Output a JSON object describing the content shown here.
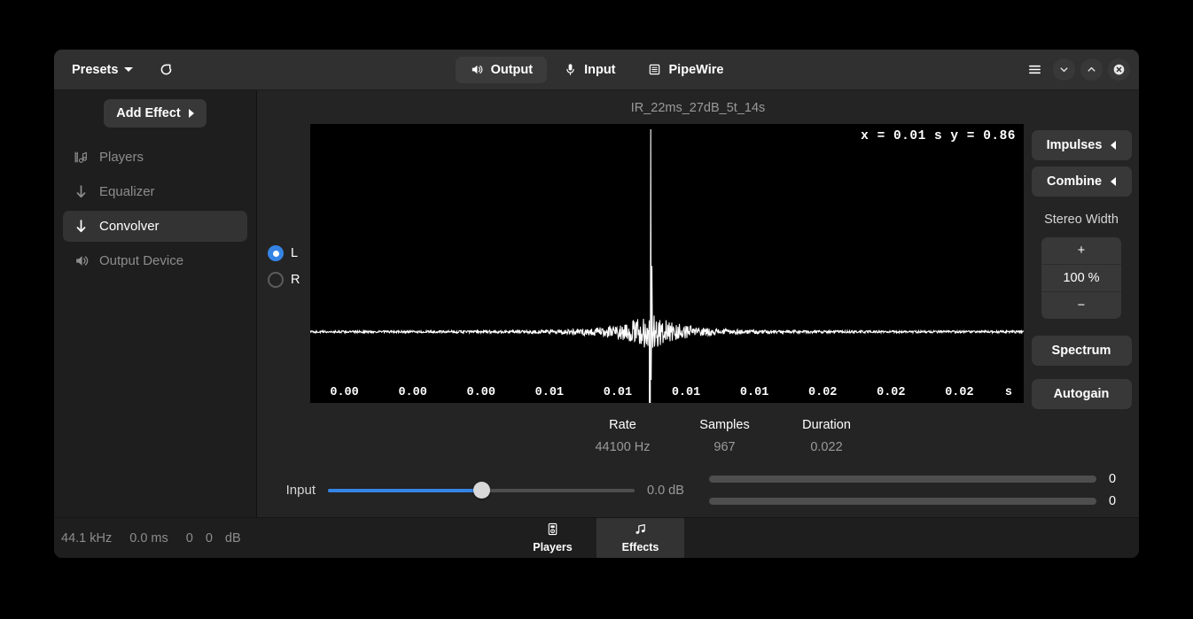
{
  "header": {
    "presets_label": "Presets",
    "presets_icon": "chevron-down-icon",
    "reset_icon": "reset-icon",
    "tabs": [
      {
        "label": "Output",
        "icon": "speaker-icon",
        "active": true
      },
      {
        "label": "Input",
        "icon": "microphone-icon",
        "active": false
      },
      {
        "label": "PipeWire",
        "icon": "list-icon",
        "active": false
      }
    ],
    "window_buttons": [
      {
        "name": "menu-button",
        "icon": "hamburger-icon"
      },
      {
        "name": "minimize-button",
        "icon": "chevron-down-icon"
      },
      {
        "name": "maximize-button",
        "icon": "chevron-up-icon"
      },
      {
        "name": "close-button",
        "icon": "close-circle-icon"
      }
    ]
  },
  "sidebar": {
    "add_effect_label": "Add Effect",
    "add_effect_icon": "chevron-right-icon",
    "items": [
      {
        "label": "Players",
        "icon": "players-icon",
        "active": false
      },
      {
        "label": "Equalizer",
        "icon": "arrow-down-icon",
        "active": false
      },
      {
        "label": "Convolver",
        "icon": "arrow-down-icon",
        "active": true
      },
      {
        "label": "Output Device",
        "icon": "speaker-icon",
        "active": false
      }
    ]
  },
  "main": {
    "ir_title": "IR_22ms_27dB_5t_14s",
    "channels": [
      {
        "label": "L",
        "selected": true
      },
      {
        "label": "R",
        "selected": false
      }
    ],
    "readout": "x = 0.01 s  y = 0.86",
    "info": [
      {
        "label": "Rate",
        "value": "44100 Hz"
      },
      {
        "label": "Samples",
        "value": "967"
      },
      {
        "label": "Duration",
        "value": "0.022"
      }
    ],
    "right_panel": {
      "impulses_label": "Impulses",
      "impulses_icon": "chevron-left-icon",
      "combine_label": "Combine",
      "combine_icon": "chevron-left-icon",
      "stereo_width_label": "Stereo Width",
      "stereo_width_plus": "+",
      "stereo_width_value": "100 %",
      "stereo_width_minus": "−",
      "spectrum_label": "Spectrum",
      "autogain_label": "Autogain"
    },
    "input": {
      "label": "Input",
      "db_value": "0.0 dB",
      "slider_percent": 50
    },
    "meters": [
      {
        "value": "0",
        "level_percent": 0
      },
      {
        "value": "0",
        "level_percent": 0
      }
    ]
  },
  "statusbar": {
    "rate": "44.1 kHz",
    "latency": "0.0 ms",
    "level_left": "0",
    "level_right": "0",
    "unit": "dB",
    "tabs": [
      {
        "label": "Players",
        "icon": "media-player-icon",
        "active": false
      },
      {
        "label": "Effects",
        "icon": "music-note-icon",
        "active": true
      }
    ]
  },
  "colors": {
    "accent": "#3584e4",
    "window_bg": "#242424",
    "sidebar_bg": "#1e1e1e",
    "header_bg": "#303030",
    "plot_bg": "#000000",
    "plot_line": "#ffffff"
  },
  "chart_data": {
    "type": "line",
    "title": "IR_22ms_27dB_5t_14s",
    "xlabel": "s",
    "ylabel": "",
    "grid": false,
    "legend": null,
    "xticks": [
      "0.00",
      "0.00",
      "0.00",
      "0.01",
      "0.01",
      "0.01",
      "0.01",
      "0.02",
      "0.02",
      "0.02"
    ],
    "xunit": "s",
    "xlim": [
      0,
      0.022
    ],
    "ylim": [
      -1,
      1
    ],
    "cursor": {
      "x": 0.01,
      "y": 0.86
    },
    "annotation": "x = 0.01 s  y = 0.86",
    "series": [
      {
        "name": "L",
        "description": "Impulse response waveform: low-amplitude noise floor across the full duration with a single dominant impulse spike near t = 0.0105 s reaching full scale positive and negative.",
        "peak_x": 0.0105,
        "peak_y": 1.0
      }
    ]
  }
}
